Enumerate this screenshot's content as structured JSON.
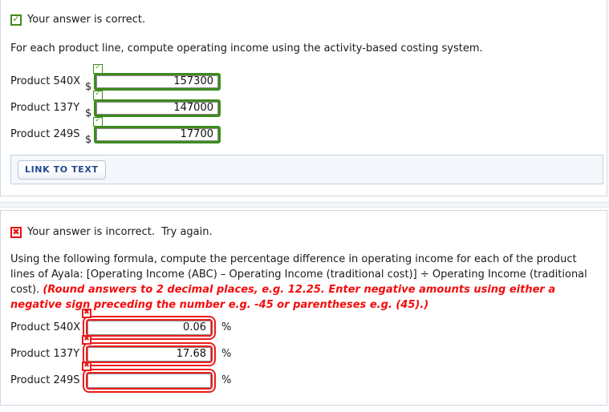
{
  "panel_one": {
    "status": {
      "icon": "checkmark-icon",
      "glyph": "✓",
      "text": "Your answer is correct.",
      "color": "#3e8a1e"
    },
    "prompt": "For each product line, compute operating income using the activity-based costing system.",
    "currency_symbol": "$",
    "rows": [
      {
        "label": "Product 540X",
        "value": "157300",
        "status_icon": "checkmark-icon",
        "status_glyph": "✓"
      },
      {
        "label": "Product 137Y",
        "value": "147000",
        "status_icon": "checkmark-icon",
        "status_glyph": "✓"
      },
      {
        "label": "Product 249S",
        "value": "17700",
        "status_icon": "checkmark-icon",
        "status_glyph": "✓"
      }
    ],
    "link_button": "LINK TO TEXT"
  },
  "panel_two": {
    "status": {
      "icon": "cross-icon",
      "glyph": "✖",
      "text": "Your answer is incorrect.  Try again.",
      "color": "#e8100f"
    },
    "prompt_plain": "Using the following formula, compute the percentage difference in operating income for each of the product lines of Ayala: [Operating Income (ABC) – Operating Income (traditional cost)] ÷ Operating Income (traditional cost). ",
    "prompt_note": "(Round answers to 2 decimal places, e.g. 12.25. Enter negative amounts using either a negative sign preceding the number e.g. -45 or parentheses e.g. (45).)",
    "percent_symbol": "%",
    "rows": [
      {
        "label": "Product 540X",
        "value": "0.06",
        "status_icon": "cross-icon",
        "status_glyph": "✖"
      },
      {
        "label": "Product 137Y",
        "value": "17.68",
        "status_icon": "cross-icon",
        "status_glyph": "✖"
      },
      {
        "label": "Product 249S",
        "value": "",
        "status_icon": "cross-icon",
        "status_glyph": "✖"
      }
    ]
  },
  "colors": {
    "correct_green": "#3e8a1e",
    "incorrect_red": "#e8100f",
    "note_red": "#f40b0b",
    "link_blue": "#1f4b8e",
    "panel_border": "#cfd8e3",
    "bar_bg": "#f4f7fb"
  }
}
